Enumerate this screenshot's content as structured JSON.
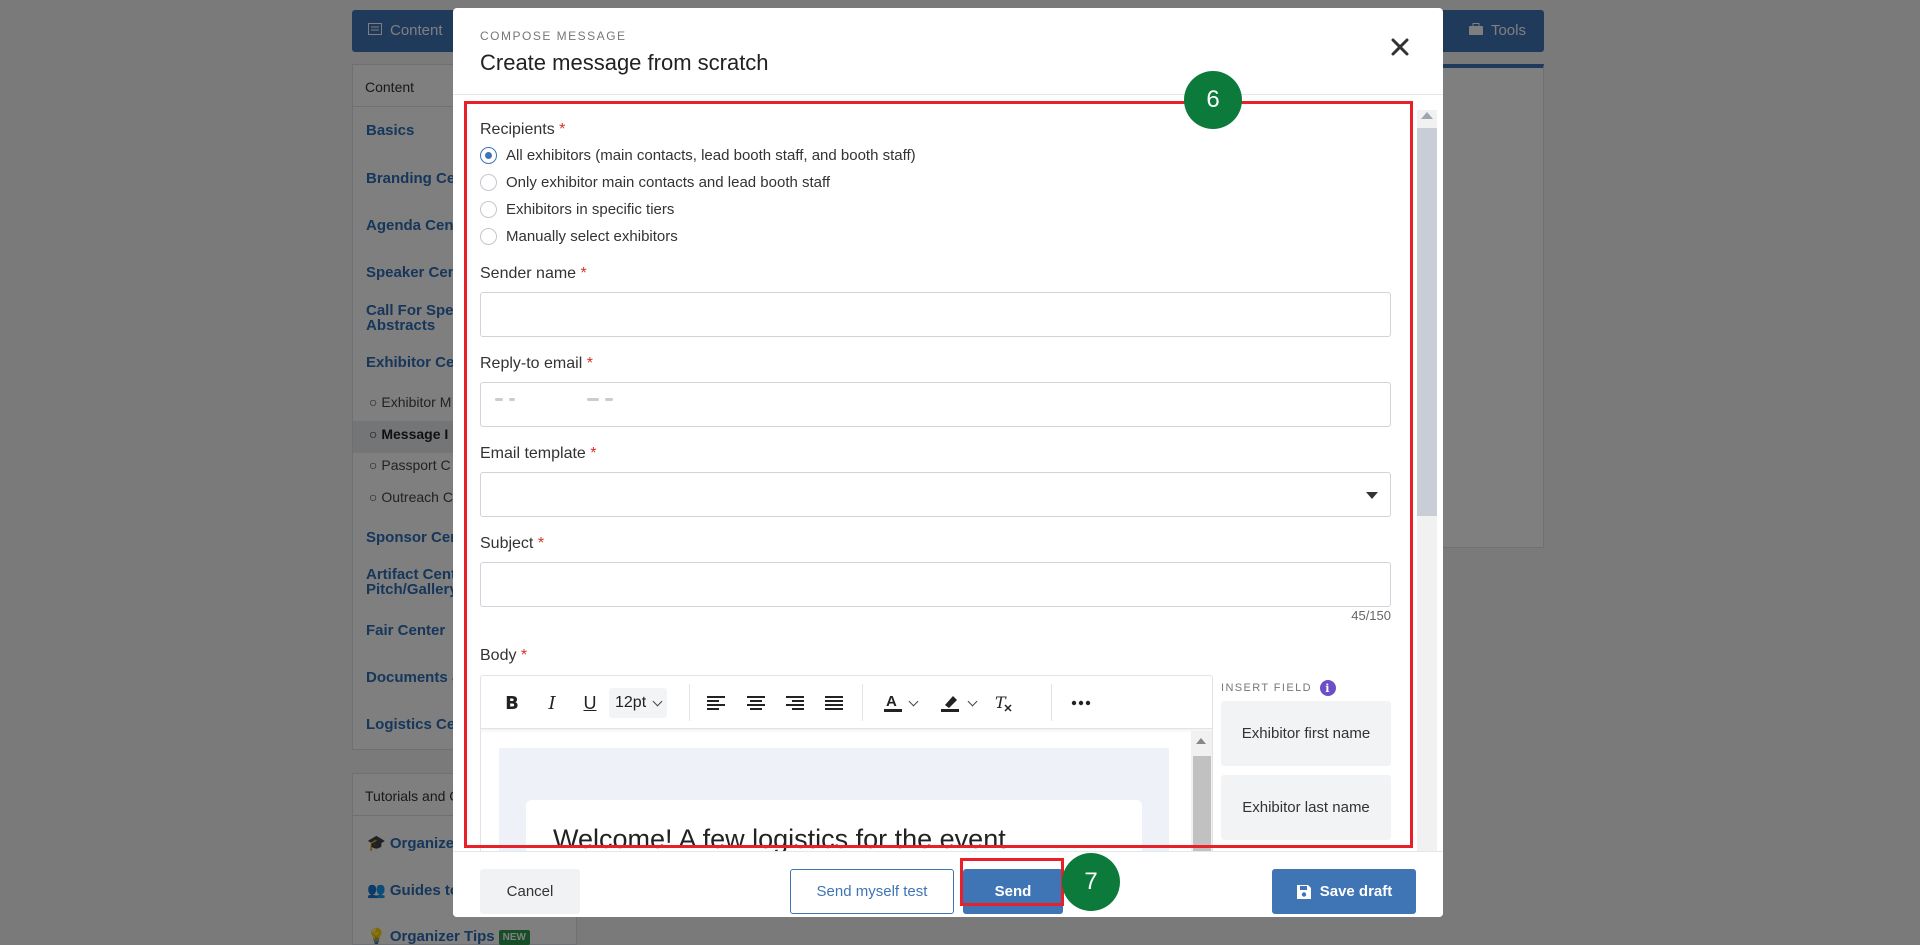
{
  "background": {
    "topbar": {
      "content_tab": "Content",
      "tools_tab": "Tools"
    },
    "sidebar": {
      "header": "Content",
      "items": [
        "Basics",
        "Branding Ce",
        "Agenda Cent",
        "Speaker Cen",
        "Call For Spea\nAbstracts",
        "Exhibitor Ce",
        "Sponsor Cer",
        "Artifact Cent\nPitch/Gallery",
        "Fair Center",
        "Documents &",
        "Logistics Ce"
      ],
      "subitems": [
        "Exhibitor M",
        "Message I",
        "Passport C",
        "Outreach C"
      ]
    },
    "tutorials": {
      "header": "Tutorials and G",
      "items": [
        "Organize",
        "Guides to",
        "Organizer Tips"
      ],
      "new_badge": "NEW"
    }
  },
  "modal": {
    "eyebrow": "COMPOSE MESSAGE",
    "title": "Create message from scratch",
    "recipients": {
      "label": "Recipients",
      "required_mark": "*",
      "options": [
        {
          "label": "All exhibitors (main contacts, lead booth staff, and booth staff)",
          "checked": true
        },
        {
          "label": "Only exhibitor main contacts and lead booth staff",
          "checked": false
        },
        {
          "label": "Exhibitors in specific tiers",
          "checked": false
        },
        {
          "label": "Manually select exhibitors",
          "checked": false
        }
      ]
    },
    "sender_name": {
      "label": "Sender name",
      "value": ""
    },
    "reply_to_email": {
      "label": "Reply-to email"
    },
    "email_template": {
      "label": "Email template",
      "value": ""
    },
    "subject": {
      "label": "Subject",
      "value": "",
      "char_count": "45/150"
    },
    "body": {
      "label": "Body",
      "font_size": "12pt",
      "content_heading": "Welcome! A few logistics for the event"
    },
    "insert_field": {
      "heading": "INSERT FIELD",
      "chips": [
        "Exhibitor first name",
        "Exhibitor last name"
      ]
    },
    "footer": {
      "cancel": "Cancel",
      "send_test": "Send myself test",
      "send": "Send",
      "save_draft": "Save draft"
    }
  },
  "annotations": {
    "step_a": "6",
    "step_b": "7"
  },
  "colors": {
    "accent": "#3f74b5",
    "annotation_red": "#e8202a",
    "step_green": "#0c7a3a"
  }
}
